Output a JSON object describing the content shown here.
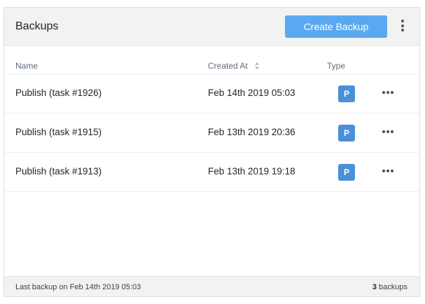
{
  "header": {
    "title": "Backups",
    "create_label": "Create Backup",
    "menu_icon": "kebab-vertical-icon"
  },
  "table": {
    "columns": [
      "Name",
      "Created At",
      "Type"
    ],
    "sort_icon": "sort-icon",
    "rows": [
      {
        "name": "Publish (task #1926)",
        "created": "Feb 14th 2019 05:03",
        "type": "P"
      },
      {
        "name": "Publish (task #1915)",
        "created": "Feb 13th 2019 20:36",
        "type": "P"
      },
      {
        "name": "Publish (task #1913)",
        "created": "Feb 13th 2019 19:18",
        "type": "P"
      }
    ]
  },
  "footer": {
    "last_backup": "Last backup on Feb 14th 2019 05:03",
    "count_number": "3",
    "count_label": "backups"
  },
  "colors": {
    "accent": "#5aa9f0",
    "badge": "#4a90d9",
    "header_bg": "#f2f2f2"
  }
}
